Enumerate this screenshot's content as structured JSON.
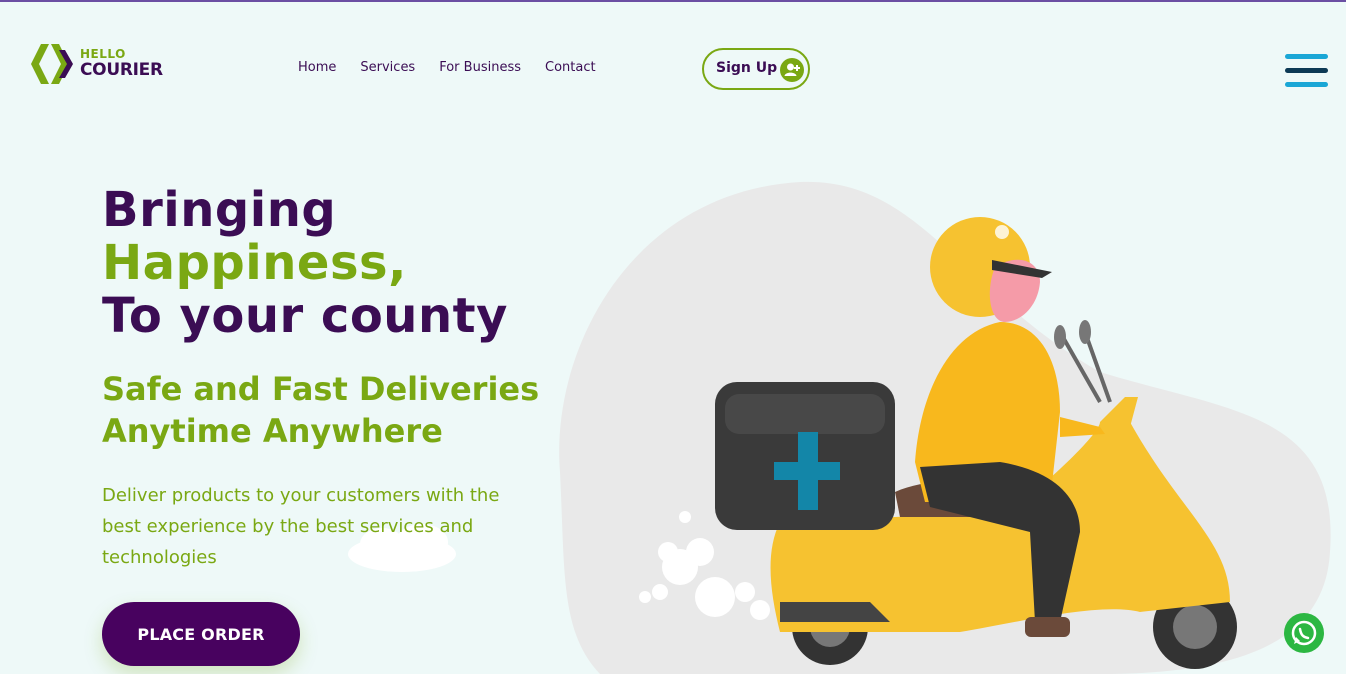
{
  "brand": {
    "hello": "HELLO",
    "courier": "COURIER"
  },
  "nav": {
    "items": [
      "Home",
      "Services",
      "For Business",
      "Contact"
    ]
  },
  "signup": {
    "label": "Sign Up"
  },
  "hero": {
    "line1": "Bringing",
    "line2": "Happiness,",
    "line3": "To your county",
    "sub1": "Safe and Fast Deliveries",
    "sub2": "Anytime Anywhere",
    "desc": "Deliver products to your customers with the best experience by the best services and technologies",
    "cta": "PLACE ORDER"
  },
  "colors": {
    "purple": "#48025f",
    "green": "#7aa813",
    "background": "#eef9f8",
    "hamburger_dark": "#0d3a55",
    "hamburger_light": "#1aa7d6",
    "whatsapp": "#2cb742"
  },
  "icons": {
    "signup": "user-plus-icon",
    "menu": "hamburger-menu-icon",
    "chat": "whatsapp-icon"
  }
}
